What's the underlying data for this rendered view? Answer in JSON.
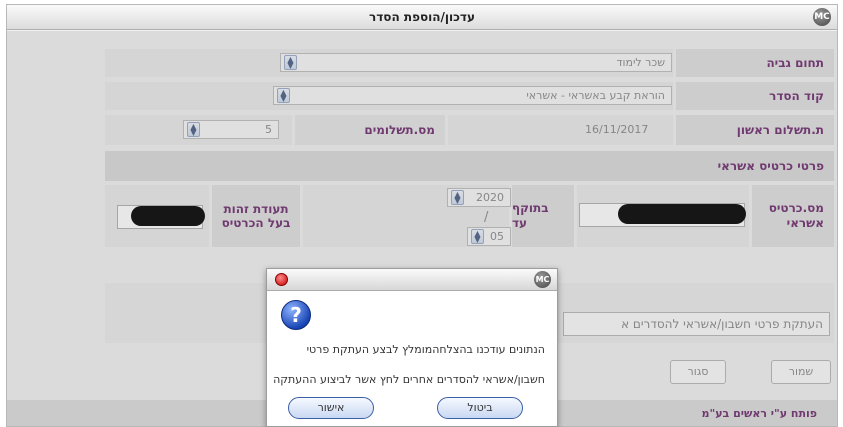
{
  "window": {
    "title": "עדכון/הוספת הסדר",
    "app_icon": "MC"
  },
  "form": {
    "collection_field": {
      "label": "תחום גביה",
      "value": "שכר לימוד"
    },
    "arrangement_code": {
      "label": "קוד הסדר",
      "value": "הוראת קבע באשראי - אשראי"
    },
    "first_payment": {
      "label": "ת.תשלום ראשון",
      "value": "16/11/2017"
    },
    "payments_count": {
      "label": "מס.תשלומים",
      "value": "5"
    },
    "card_section_title": "פרטי כרטיס אשראי",
    "card_number_label": "מס.כרטיס אשראי",
    "valid_until_label": "בתוקף עד",
    "expiry_year": "2020",
    "expiry_separator": "/",
    "expiry_month": "05",
    "card_owner_id_label": "תעודת זהות בעל הכרטיס",
    "copy_details_text": "העתקת פרטי חשבון/אשראי להסדרים א",
    "close_button": "סגור",
    "save_button": "שמור"
  },
  "footer": {
    "text": "פותח ע\"י ראשים בע\"מ"
  },
  "dialog": {
    "app_icon": "MC",
    "message_line1": "הנתונים עודכנו בהצלחהמומלץ לבצע העתקת פרטי",
    "message_line2": "חשבון/אשראי להסדרים אחרים לחץ אשר לביצוע ההעתקה",
    "ok_button": "אישור",
    "cancel_button": "ביטול"
  },
  "colors": {
    "label_text": "#6e2d6e",
    "dialog_button_border": "#3b5fa8",
    "close_red": "#c40000"
  },
  "icons": [
    "app-logo-icon",
    "spinner-icon",
    "close-icon",
    "question-icon"
  ]
}
